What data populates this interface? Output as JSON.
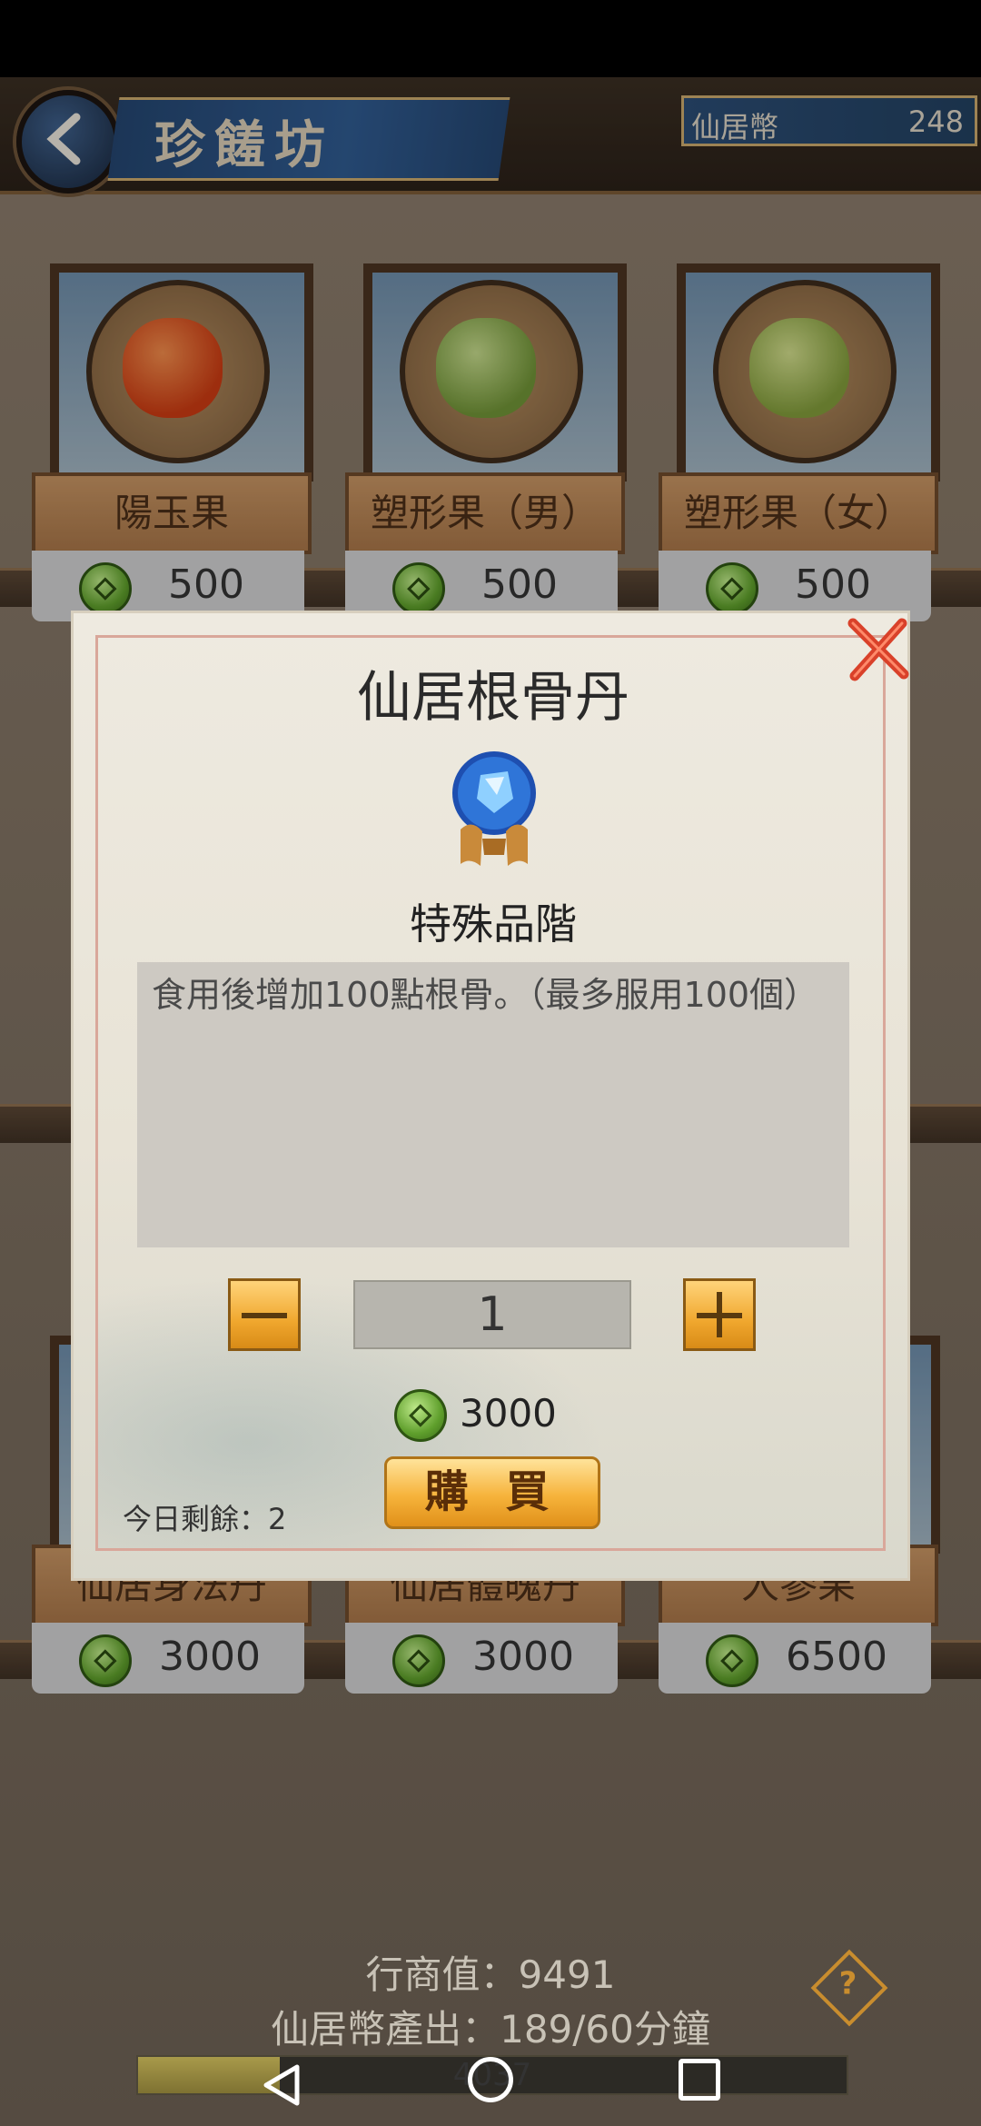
{
  "header": {
    "title": "珍饈坊",
    "currency_label": "仙居幣",
    "currency_value": "248"
  },
  "items": [
    {
      "name": "陽玉果",
      "price": "500",
      "color": "#d94d1f"
    },
    {
      "name": "塑形果（男）",
      "price": "500",
      "color": "#7fa04a"
    },
    {
      "name": "塑形果（女）",
      "price": "500",
      "color": "#8fa64a"
    },
    {
      "name": "仙居身法丹",
      "price": "3000"
    },
    {
      "name": "仙居體魄丹",
      "price": "3000"
    },
    {
      "name": "人參果",
      "price": "6500"
    }
  ],
  "footer": {
    "merchant_value": "行商值：9491",
    "coin_output": "仙居幣產出：189/60分鐘",
    "progress_text": "4037",
    "progress_ratio": 0.2
  },
  "dialog": {
    "title": "仙居根骨丹",
    "quality": "特殊品階",
    "description": "食用後增加100點根骨。（最多服用100個）",
    "quantity": "1",
    "total_price": "3000",
    "buy_label": "購 買",
    "remaining": "今日剩餘：2"
  },
  "icons": {
    "back": "chevron-left-icon",
    "close": "close-x-icon",
    "help": "question-diamond-icon",
    "coin": "coin-icon",
    "item": "blue-gem-icon"
  },
  "colors": {
    "accent_gold": "#f0a72e",
    "close_red": "#d9412a",
    "banner_blue": "#2f5a8f"
  }
}
